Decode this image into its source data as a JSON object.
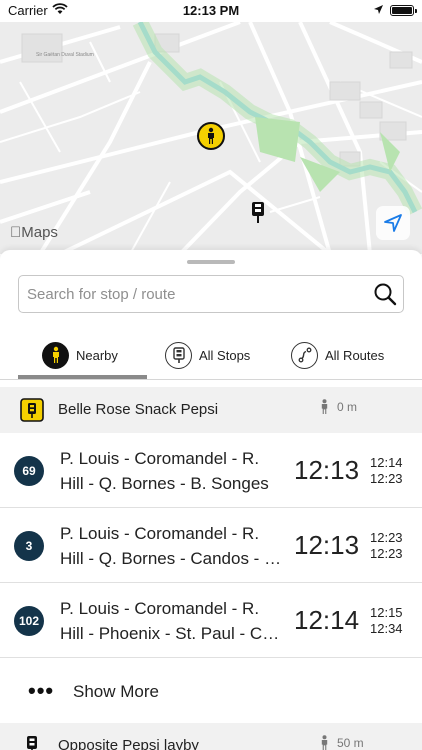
{
  "status_bar": {
    "carrier": "Carrier",
    "time": "12:13 PM"
  },
  "map": {
    "attribution": "Maps",
    "stadium_label": "Sir Gaëtan Duval Stadium"
  },
  "search": {
    "placeholder": "Search for stop / route",
    "value": ""
  },
  "tabs": [
    {
      "label": "Nearby",
      "icon": "walking-person-icon",
      "selected": true
    },
    {
      "label": "All Stops",
      "icon": "bus-stop-icon",
      "selected": false
    },
    {
      "label": "All Routes",
      "icon": "route-icon",
      "selected": false
    }
  ],
  "stops": [
    {
      "name": "Belle Rose Snack Pepsi",
      "distance": "0 m",
      "routes": [
        {
          "number": "69",
          "name_line1": "P. Louis - Coromandel - R.",
          "name_line2": "Hill - Q. Bornes - B. Songes",
          "time": "12:13",
          "next1": "12:14",
          "next2": "12:23"
        },
        {
          "number": "3",
          "name_line1": "P. Louis - Coromandel - R.",
          "name_line2": "Hill - Q. Bornes - Candos - Curepipe",
          "time": "12:13",
          "next1": "12:23",
          "next2": "12:23"
        },
        {
          "number": "102",
          "name_line1": "P. Louis - Coromandel - R.",
          "name_line2": "Hill - Phoenix - St. Paul - Curepipe",
          "time": "12:14",
          "next1": "12:15",
          "next2": "12:34"
        }
      ],
      "show_more": "Show More"
    },
    {
      "name": "Opposite Pepsi layby",
      "distance": "50 m"
    }
  ],
  "colors": {
    "pin_yellow": "#f5d000",
    "route_badge": "#14344a",
    "locate_blue": "#1a7ce8"
  }
}
